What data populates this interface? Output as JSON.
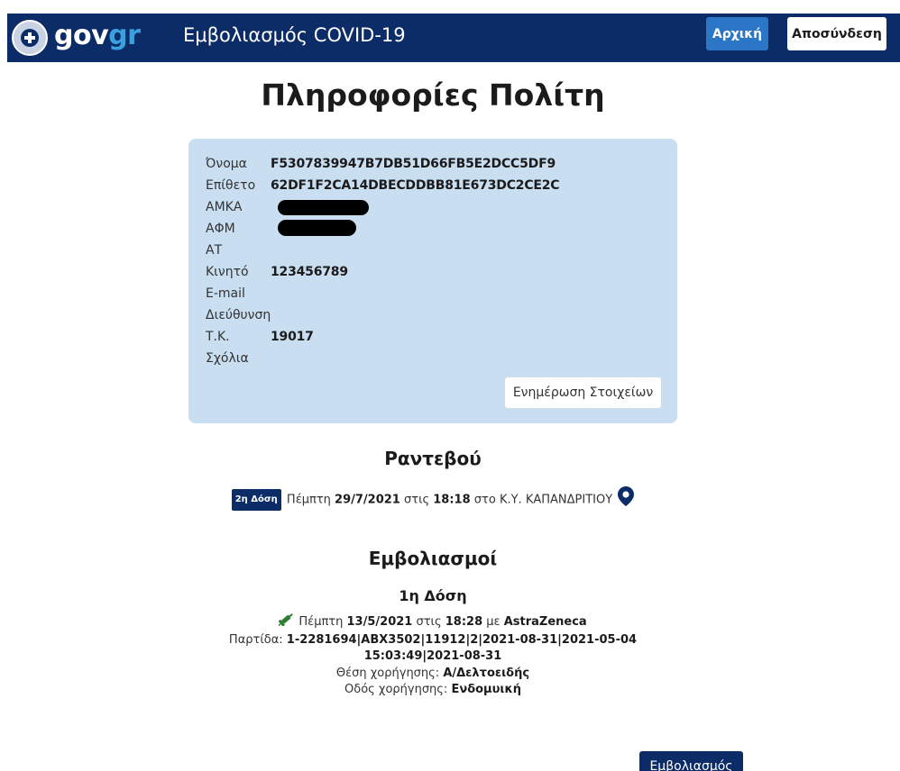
{
  "header": {
    "logo_gov": "gov",
    "logo_gr": "gr",
    "app_title": "Εμβολιασμός COVID-19",
    "home_label": "Αρχική",
    "logout_label": "Αποσύνδεση"
  },
  "page_title": "Πληροφορίες Πολίτη",
  "citizen": {
    "rows": [
      {
        "label": "Όνομα",
        "value": "F5307839947B7DB51D66FB5E2DCC5DF9"
      },
      {
        "label": "Επίθετο",
        "value": "62DF1F2CA14DBECDDBB81E673DC2CE2C"
      },
      {
        "label": "ΑΜΚΑ",
        "value": ""
      },
      {
        "label": "ΑΦΜ",
        "value": ""
      },
      {
        "label": "ΑΤ",
        "value": ""
      },
      {
        "label": "Κινητό",
        "value": "123456789"
      },
      {
        "label": "E-mail",
        "value": ""
      },
      {
        "label": "Διεύθυνση",
        "value": ""
      },
      {
        "label": "Τ.Κ.",
        "value": "19017"
      },
      {
        "label": "Σχόλια",
        "value": ""
      }
    ],
    "update_label": "Ενημέρωση Στοιχείων"
  },
  "appointment": {
    "section_title": "Ραντεβού",
    "dose_badge": "2η Δόση",
    "day": "Πέμπτη",
    "date": "29/7/2021",
    "at_word": "στις",
    "time": "18:18",
    "place_prefix": "στο",
    "place": "Κ.Υ. ΚΑΠΑΝΔΡΙΤΙΟΥ"
  },
  "vaccinations": {
    "section_title": "Εμβολιασμοί",
    "dose_title": "1η Δόση",
    "day": "Πέμπτη",
    "date": "13/5/2021",
    "at_word": "στις",
    "time": "18:28",
    "with_word": "με",
    "vaccine": "AstraZeneca",
    "batch_label": "Παρτίδα:",
    "batch_value": "1-2281694|ABX3502|11912|2|2021-08-31|2021-05-04 15:03:49|2021-08-31",
    "site_label": "Θέση χορήγησης:",
    "site_value": "Α/Δελτοειδής",
    "route_label": "Οδός χορήγησης:",
    "route_value": "Ενδομυική"
  },
  "vaccinate_button": "Εμβολιασμός",
  "colors": {
    "header_bg": "#0b2c66",
    "accent_blue": "#2b76c7",
    "logo_gr": "#3da0de",
    "card_bg": "#c9def0"
  }
}
